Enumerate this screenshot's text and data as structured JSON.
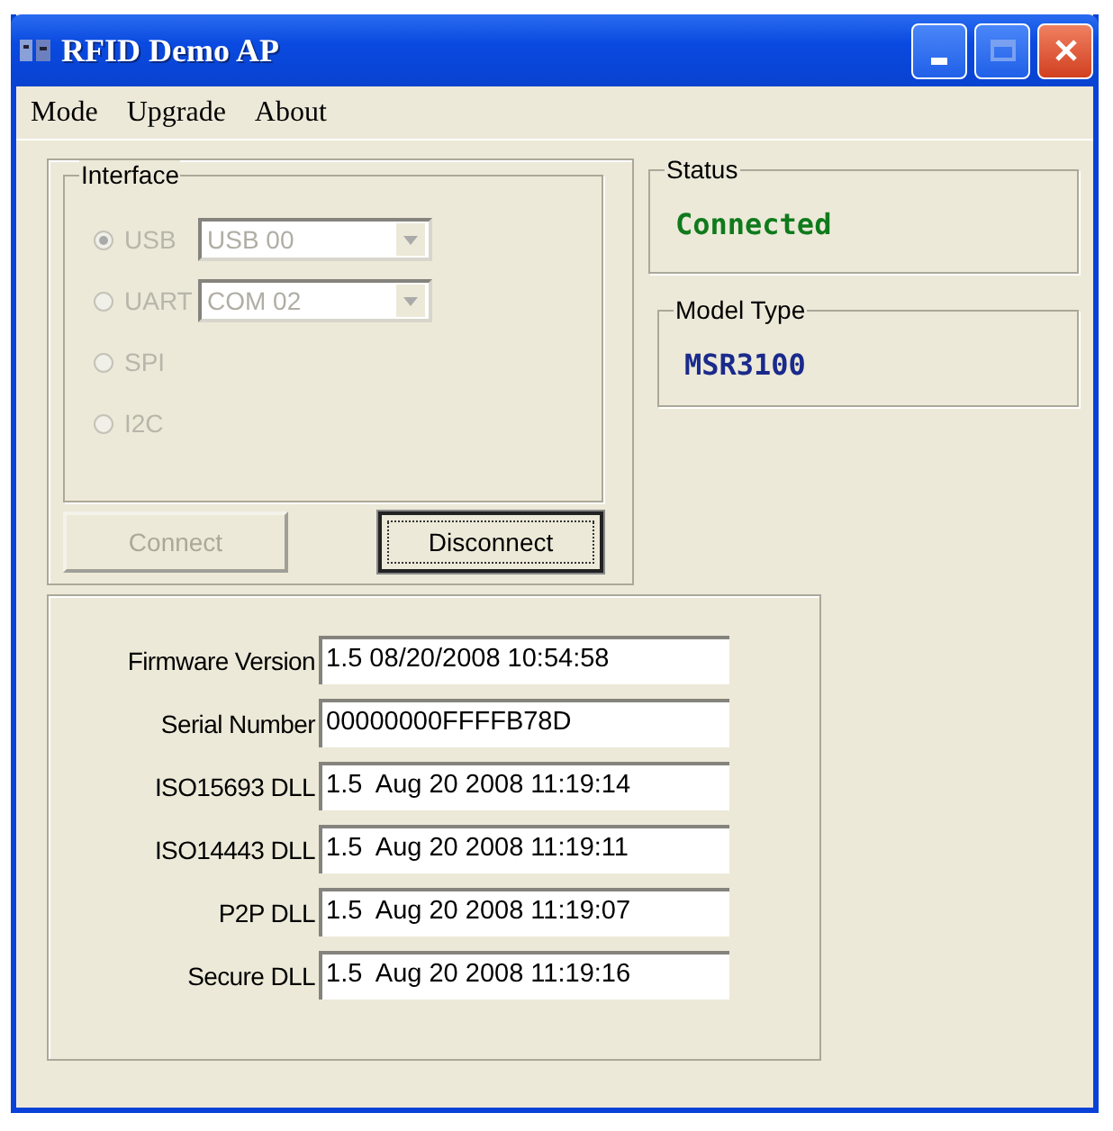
{
  "window": {
    "title": "RFID Demo AP"
  },
  "menu": [
    "Mode",
    "Upgrade",
    "About"
  ],
  "interface": {
    "title": "Interface",
    "options": [
      {
        "label": "USB",
        "selected": true,
        "disabled": true,
        "dropdown": "USB 00"
      },
      {
        "label": "UART",
        "selected": false,
        "disabled": true,
        "dropdown": "COM 02"
      },
      {
        "label": "SPI",
        "selected": false,
        "disabled": true
      },
      {
        "label": "I2C",
        "selected": false,
        "disabled": true
      }
    ]
  },
  "buttons": [
    {
      "label": "Connect",
      "disabled": true,
      "focused": false
    },
    {
      "label": "Disconnect",
      "disabled": false,
      "focused": true
    }
  ],
  "status": {
    "title": "Status",
    "value": "Connected"
  },
  "model_type": {
    "title": "Model Type",
    "value": "MSR3100"
  },
  "info": [
    {
      "label": "Firmware Version",
      "value": "1.5 08/20/2008 10:54:58"
    },
    {
      "label": "Serial Number",
      "value": "00000000FFFFB78D"
    },
    {
      "label": "ISO15693 DLL",
      "value": "1.5  Aug 20 2008 11:19:14"
    },
    {
      "label": "ISO14443 DLL",
      "value": "1.5  Aug 20 2008 11:19:11"
    },
    {
      "label": "P2P DLL",
      "value": "1.5  Aug 20 2008 11:19:07"
    },
    {
      "label": "Secure DLL",
      "value": "1.5  Aug 20 2008 11:19:16"
    }
  ]
}
